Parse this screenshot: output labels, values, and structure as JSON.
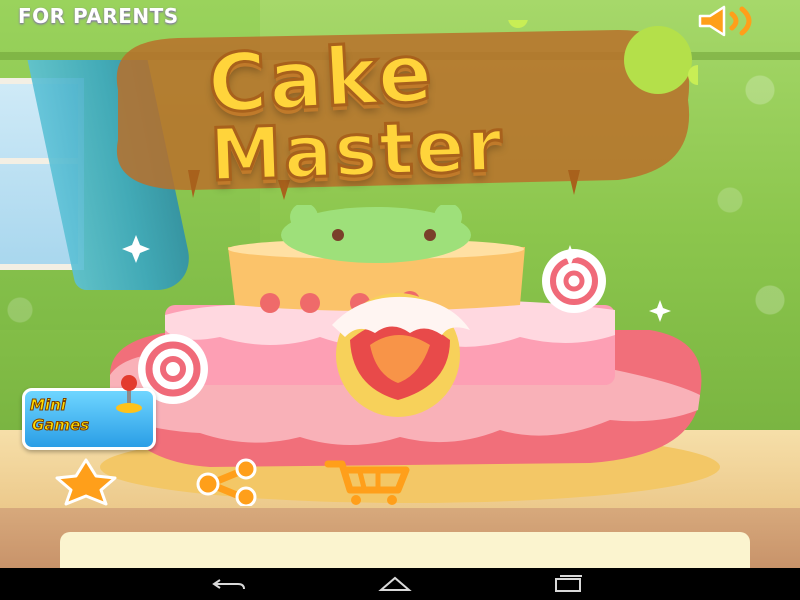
{
  "header": {
    "for_parents_label": "FOR PARENTS",
    "sound_icon": "speaker-icon"
  },
  "logo": {
    "line1": "Cake",
    "line2": "Master"
  },
  "mini_games": {
    "line1": "Mini",
    "line2": "Games",
    "icon": "joystick-icon"
  },
  "actions": {
    "rate_icon": "star-icon",
    "share_icon": "share-icon",
    "shop_icon": "cart-icon"
  },
  "navigation": {
    "back_icon": "back-icon",
    "home_icon": "home-icon",
    "recent_icon": "recent-apps-icon"
  },
  "colors": {
    "logo_fill": "#ffd43b",
    "logo_outline": "#a8611c",
    "accent_blue": "#2a9ee6",
    "icon_orange": "#ff9f1a"
  }
}
